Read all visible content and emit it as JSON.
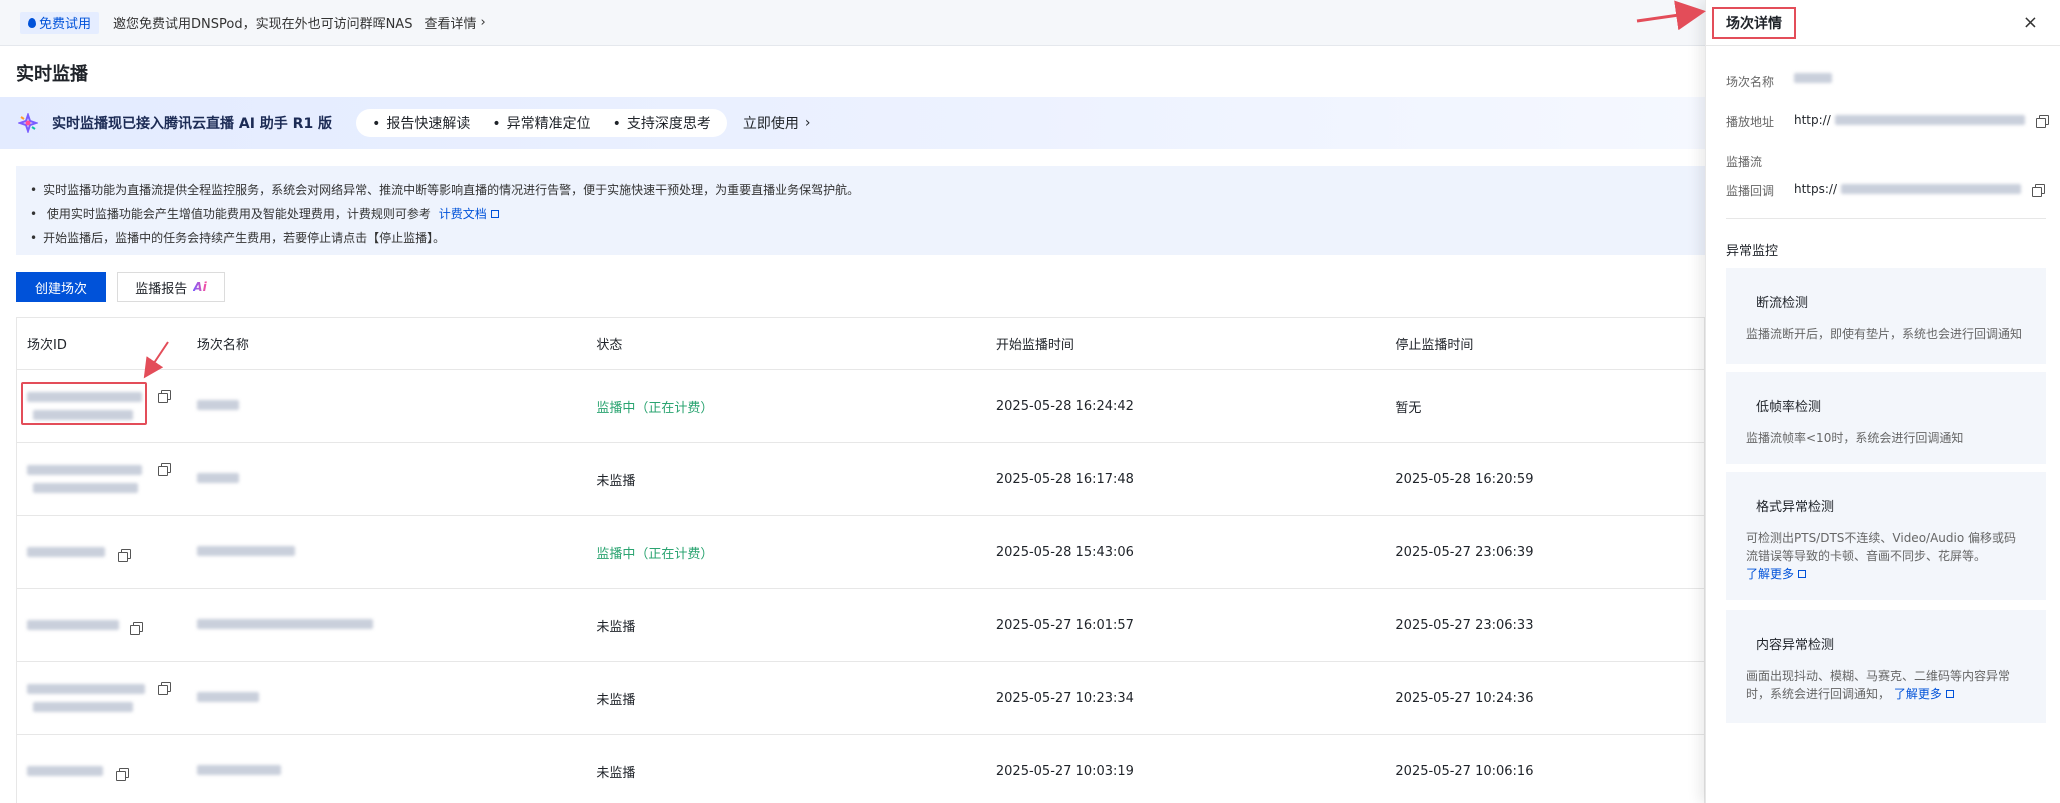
{
  "topbar": {
    "badge": "免费试用",
    "text": "邀您免费试用DNSPod，实现在外也可访问群晖NAS",
    "link": "查看详情"
  },
  "page": {
    "title": "实时监播"
  },
  "ai_banner": {
    "title": "实时监播现已接入腾讯云直播 AI 助手 R1 版",
    "features": [
      "报告快速解读",
      "异常精准定位",
      "支持深度思考"
    ],
    "cta": "立即使用"
  },
  "info": {
    "line1": "实时监播功能为直播流提供全程监控服务，系统会对网络异常、推流中断等影响直播的情况进行告警，便于实施快速干预处理，为重要直播业务保驾护航。",
    "line2": "使用实时监播功能会产生增值功能费用及智能处理费用，计费规则可参考",
    "line2_link": "计费文档",
    "line3": "开始监播后，监播中的任务会持续产生费用，若要停止请点击【停止监播】。"
  },
  "buttons": {
    "create": "创建场次",
    "report": "监播报告",
    "report_ai": "Ai"
  },
  "table": {
    "headers": [
      "场次ID",
      "场次名称",
      "状态",
      "开始监播时间",
      "停止监播时间"
    ],
    "rows": [
      {
        "status": "监播中（正在计费）",
        "active": true,
        "start": "2025-05-28 16:24:42",
        "stop": "暂无"
      },
      {
        "status": "未监播",
        "active": false,
        "start": "2025-05-28 16:17:48",
        "stop": "2025-05-28 16:20:59"
      },
      {
        "status": "监播中（正在计费）",
        "active": true,
        "start": "2025-05-28 15:43:06",
        "stop": "2025-05-27 23:06:39"
      },
      {
        "status": "未监播",
        "active": false,
        "start": "2025-05-27 16:01:57",
        "stop": "2025-05-27 23:06:33"
      },
      {
        "status": "未监播",
        "active": false,
        "start": "2025-05-27 10:23:34",
        "stop": "2025-05-27 10:24:36"
      },
      {
        "status": "未监播",
        "active": false,
        "start": "2025-05-27 10:03:19",
        "stop": "2025-05-27 10:06:16"
      }
    ]
  },
  "panel": {
    "title": "场次详情",
    "close": "×",
    "name_label": "场次名称",
    "play_label": "播放地址",
    "play_prefix": "http://",
    "stream_label": "监播流",
    "callback_label": "监播回调",
    "callback_prefix": "https://",
    "section": "异常监控",
    "cards": [
      {
        "title": "断流检测",
        "desc": "监播流断开后，即使有垫片，系统也会进行回调通知"
      },
      {
        "title": "低帧率检测",
        "desc": "监播流帧率<10时，系统会进行回调通知"
      },
      {
        "title": "格式异常检测",
        "desc": "可检测出PTS/DTS不连续、Video/Audio 偏移或码流错误等导致的卡顿、音画不同步、花屏等。",
        "link": "了解更多"
      },
      {
        "title": "内容异常检测",
        "desc": "画面出现抖动、模糊、马赛克、二维码等内容异常时，系统会进行回调通知，",
        "link": "了解更多"
      }
    ]
  },
  "colors": {
    "accent": "#0052d9",
    "active": "#2ba471",
    "highlight": "#e34d59"
  }
}
